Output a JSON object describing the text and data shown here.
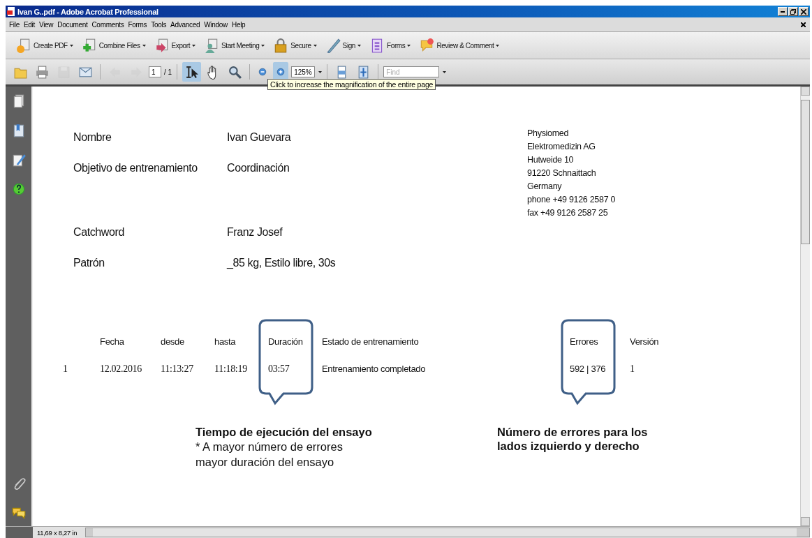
{
  "window": {
    "title": "Ivan G..pdf - Adobe Acrobat Professional"
  },
  "menu": [
    "File",
    "Edit",
    "View",
    "Document",
    "Comments",
    "Forms",
    "Tools",
    "Advanced",
    "Window",
    "Help"
  ],
  "task_buttons": [
    {
      "kind": "create",
      "label": "Create PDF"
    },
    {
      "kind": "combine",
      "label": "Combine Files"
    },
    {
      "kind": "export",
      "label": "Export"
    },
    {
      "kind": "meeting",
      "label": "Start Meeting"
    },
    {
      "kind": "secure",
      "label": "Secure"
    },
    {
      "kind": "sign",
      "label": "Sign"
    },
    {
      "kind": "forms",
      "label": "Forms"
    },
    {
      "kind": "review",
      "label": "Review & Comment"
    }
  ],
  "tools": [
    {
      "kind": "open",
      "selected": false,
      "disabled": false
    },
    {
      "kind": "print",
      "selected": false,
      "disabled": false
    },
    {
      "kind": "save",
      "selected": false,
      "disabled": true
    },
    {
      "kind": "email",
      "selected": false,
      "disabled": false
    },
    {
      "kind": "sep"
    },
    {
      "kind": "previous",
      "selected": false,
      "disabled": true
    },
    {
      "kind": "next",
      "selected": false,
      "disabled": true
    },
    {
      "kind": "page",
      "value": "1",
      "total": "/ 1"
    },
    {
      "kind": "sep"
    },
    {
      "kind": "select",
      "selected": true,
      "disabled": false
    },
    {
      "kind": "hand",
      "selected": false,
      "disabled": false
    },
    {
      "kind": "zoom",
      "selected": false,
      "disabled": false
    },
    {
      "kind": "sep"
    },
    {
      "kind": "zoomout",
      "selected": false,
      "disabled": false
    },
    {
      "kind": "zoomin",
      "selected": true,
      "disabled": false
    },
    {
      "kind": "zoomlevel",
      "value": "125%"
    },
    {
      "kind": "sep"
    },
    {
      "kind": "fitpage",
      "selected": false,
      "disabled": false
    },
    {
      "kind": "fullscreen",
      "selected": false,
      "disabled": false
    },
    {
      "kind": "sep"
    },
    {
      "kind": "find",
      "placeholder": "Find"
    }
  ],
  "tooltip": "Click to increase the magnification of the entire page",
  "sidebar": [
    {
      "kind": "pages"
    },
    {
      "kind": "bookmarks"
    },
    {
      "kind": "signatures"
    },
    {
      "kind": "help"
    },
    {
      "kind": "spacer"
    },
    {
      "kind": "attachments"
    },
    {
      "kind": "comments"
    }
  ],
  "document": {
    "fields": [
      {
        "label": "Nombre",
        "value": "Ivan Guevara"
      },
      {
        "label": "Objetivo de entrenamiento",
        "value": "Coordinación"
      },
      {
        "label": "Catchword",
        "value": "Franz Josef"
      },
      {
        "label": "Patrón",
        "value": "_85 kg, Estilo libre, 30s"
      }
    ],
    "address": [
      "Physiomed",
      "Elektromedizin AG",
      "Hutweide 10",
      "91220 Schnaittach",
      "Germany",
      "phone +49 9126 2587 0",
      "fax +49 9126 2587 25"
    ],
    "table": {
      "columns": [
        "",
        "Fecha",
        "desde",
        "hasta",
        "Duración",
        "Estado de entrenamiento",
        "Errores",
        "Versión"
      ],
      "rows": [
        [
          "1",
          "12.02.2016",
          "11:13:27",
          "11:18:19",
          "03:57",
          "Entrenamiento completado",
          "592 | 376",
          "1"
        ]
      ]
    },
    "callouts": [
      {
        "title": "Tiempo de ejecución del ensayo",
        "note": "* A mayor número de errores mayor duración del ensayo"
      },
      {
        "title": "Número de errores para los lados izquierdo y derecho"
      }
    ]
  },
  "status_bar": {
    "page_size": "11,69 x 8,27 in"
  }
}
